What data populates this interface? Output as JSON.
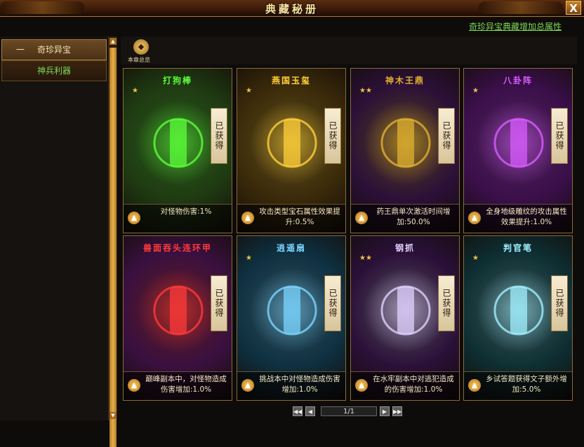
{
  "window": {
    "title": "典藏秘册",
    "close_label": "X"
  },
  "top_link": "奇珍异宝典藏增加总属性",
  "sidebar": {
    "items": [
      {
        "prefix": "一",
        "label": "奇珍异宝"
      },
      {
        "prefix": "",
        "label": "神兵利器"
      }
    ]
  },
  "chapter": {
    "caption": "本章总览"
  },
  "cards": [
    {
      "name": "打狗棒",
      "stars": "★",
      "badge": "已获得",
      "desc": "对怪物伤害:1%",
      "theme": "#1f3a12",
      "accent": "#5cff3a"
    },
    {
      "name": "燕国玉玺",
      "stars": "★",
      "badge": "已获得",
      "desc": "攻击类型宝石属性效果提升:0.5%",
      "theme": "#3a2a0a",
      "accent": "#ffcf3a"
    },
    {
      "name": "神木王鼎",
      "stars": "★★",
      "badge": "已获得",
      "desc": "药王鼎单次激活时间增加:50.0%",
      "theme": "#2c1038",
      "accent": "#e0b030"
    },
    {
      "name": "八卦阵",
      "stars": "★",
      "badge": "已获得",
      "desc": "全身地级雕纹的攻击属性效果提升:1.0%",
      "theme": "#3a0f4a",
      "accent": "#d85cff"
    },
    {
      "name": "兽面吞头连环甲",
      "stars": "",
      "badge": "已获得",
      "desc": "巅峰副本中，对怪物造成伤害增加:1.0%",
      "theme": "#3a1040",
      "accent": "#ff3a3a"
    },
    {
      "name": "逍遥扇",
      "stars": "★",
      "badge": "已获得",
      "desc": "挑战本中对怪物造成伤害增加:1.0%",
      "theme": "#0e3040",
      "accent": "#7ad4ff"
    },
    {
      "name": "钢抓",
      "stars": "★★",
      "badge": "已获得",
      "desc": "在水牢副本中对逃犯造成的伤害增加:1.0%",
      "theme": "#2a1038",
      "accent": "#e0d0ff"
    },
    {
      "name": "判官笔",
      "stars": "★",
      "badge": "已获得",
      "desc": "乡试答题获得文子额外增加:5.0%",
      "theme": "#0e2f33",
      "accent": "#a0f0ff"
    }
  ],
  "pager": {
    "page": "1/1"
  }
}
